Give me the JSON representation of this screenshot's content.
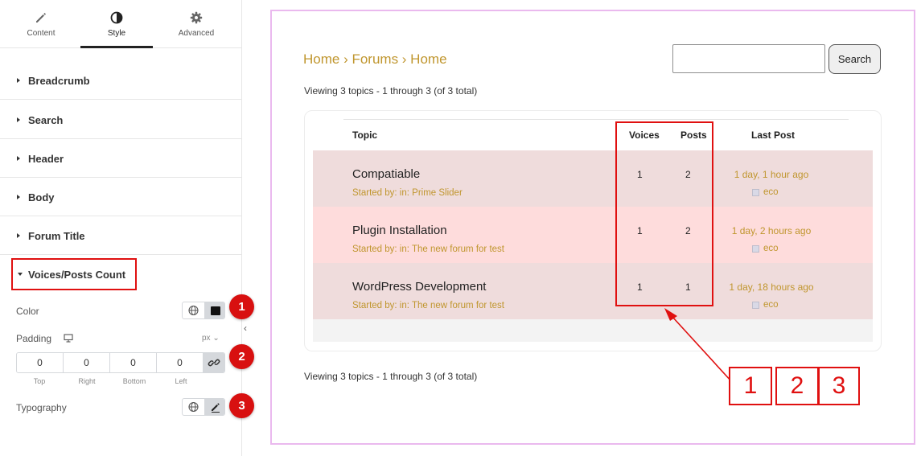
{
  "tabs": [
    {
      "label": "Content",
      "icon": "pencil-icon"
    },
    {
      "label": "Style",
      "icon": "contrast-icon"
    },
    {
      "label": "Advanced",
      "icon": "gear-icon"
    }
  ],
  "sections": [
    "Breadcrumb",
    "Search",
    "Header",
    "Body",
    "Forum Title"
  ],
  "open_section": {
    "title": "Voices/Posts Count",
    "color_label": "Color",
    "padding_label": "Padding",
    "padding_unit": "px",
    "padding": {
      "top": "0",
      "right": "0",
      "bottom": "0",
      "left": "0"
    },
    "padding_sides": [
      "Top",
      "Right",
      "Bottom",
      "Left"
    ],
    "typography_label": "Typography"
  },
  "badges": [
    "1",
    "2",
    "3"
  ],
  "preview": {
    "breadcrumb": "Home › Forums › Home",
    "search_button": "Search",
    "viewing_top": "Viewing 3 topics - 1 through 3 (of 3 total)",
    "viewing_bottom": "Viewing 3 topics - 1 through 3 (of 3 total)",
    "headers": {
      "topic": "Topic",
      "voices": "Voices",
      "posts": "Posts",
      "last_post": "Last Post"
    },
    "rows": [
      {
        "title": "Compatiable",
        "meta": "Started by: in: Prime Slider",
        "voices": "1",
        "posts": "2",
        "last_post": "1 day, 1 hour ago",
        "user": "eco",
        "bg": "#efdcdc"
      },
      {
        "title": "Plugin Installation",
        "meta": "Started by: in: The new forum for test",
        "voices": "1",
        "posts": "2",
        "last_post": "1 day, 2 hours ago",
        "user": "eco",
        "bg": "#fedcdc"
      },
      {
        "title": "WordPress Development",
        "meta": "Started by: in: The new forum for test",
        "voices": "1",
        "posts": "1",
        "last_post": "1 day, 18 hours ago",
        "user": "eco",
        "bg": "#efdcdc"
      }
    ]
  },
  "callouts": [
    "1",
    "2",
    "3"
  ],
  "colors": {
    "accent": "#c0962e",
    "annotation": "#e01010",
    "frame": "#eab9ee"
  }
}
